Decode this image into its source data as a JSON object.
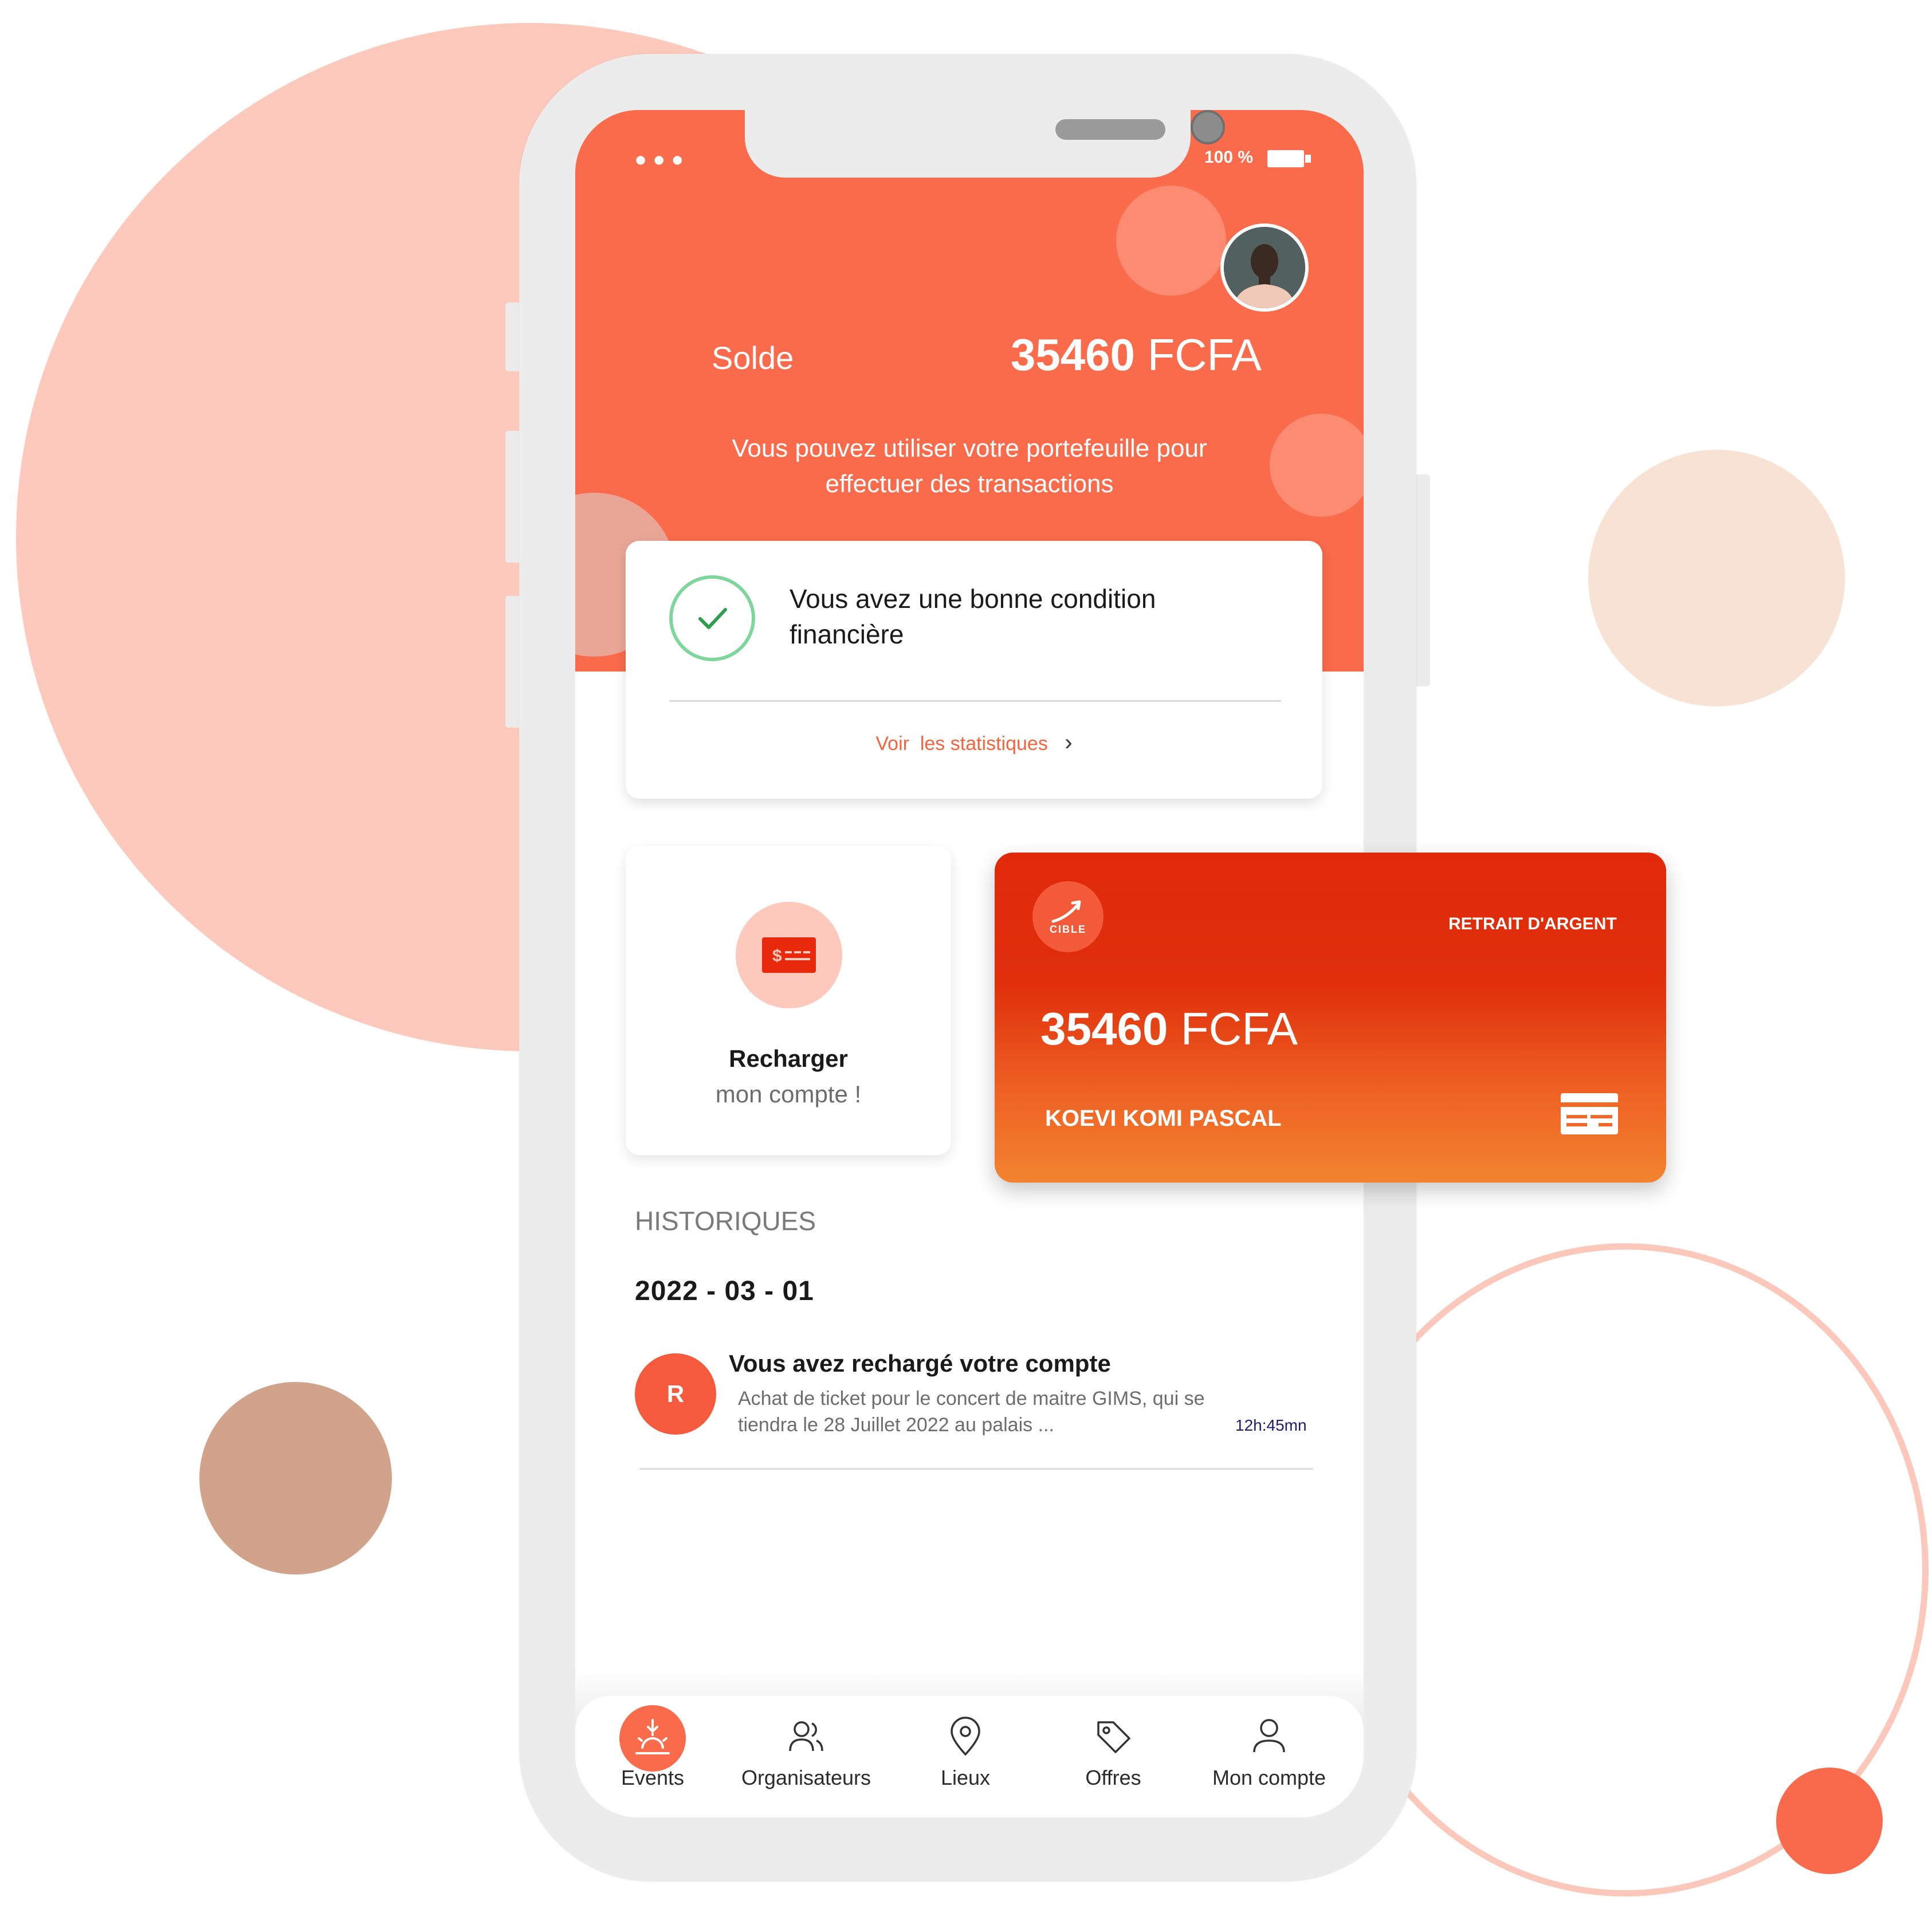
{
  "status_bar": {
    "dots": "•••",
    "battery": "100 %"
  },
  "header": {
    "solde_label": "Solde",
    "balance_number": "35460",
    "balance_currency": "FCFA",
    "description": "Vous pouvez utiliser votre portefeuille pour effectuer des transactions"
  },
  "finance_card": {
    "message": "Vous avez une bonne condition financière",
    "link": "Voir  les statistiques",
    "link_chevron": "›",
    "status_color": "#7fd69d"
  },
  "recharge_card": {
    "title": "Recharger",
    "subtitle": "mon compte !",
    "icon": "money-card-icon"
  },
  "withdraw_card": {
    "logo_text": "CIBLE",
    "label": "RETRAIT D'ARGENT",
    "amount_number": "35460",
    "amount_currency": "FCFA",
    "holder": "KOEVI KOMI PASCAL",
    "icon": "credit-card-icon"
  },
  "history": {
    "title": "HISTORIQUES",
    "date": "2022 - 03 - 01",
    "items": [
      {
        "initial": "R",
        "title": "Vous avez rechargé votre compte",
        "description": "Achat de ticket pour le concert de maitre GIMS, qui se tiendra le 28 Juillet 2022 au palais ...",
        "time": "12h:45mn"
      }
    ]
  },
  "nav": {
    "items": [
      {
        "label": "Events",
        "icon": "sunrise-icon",
        "active": true
      },
      {
        "label": "Organisateurs",
        "icon": "users-icon",
        "active": false
      },
      {
        "label": "Lieux",
        "icon": "map-pin-icon",
        "active": false
      },
      {
        "label": "Offres",
        "icon": "tag-icon",
        "active": false
      },
      {
        "label": "Mon compte",
        "icon": "user-icon",
        "active": false
      }
    ]
  },
  "colors": {
    "accent": "#f96b4b",
    "card_gradient_top": "#e0290a",
    "card_gradient_bottom": "#f2832f",
    "light_peach": "#fdc9bd"
  }
}
